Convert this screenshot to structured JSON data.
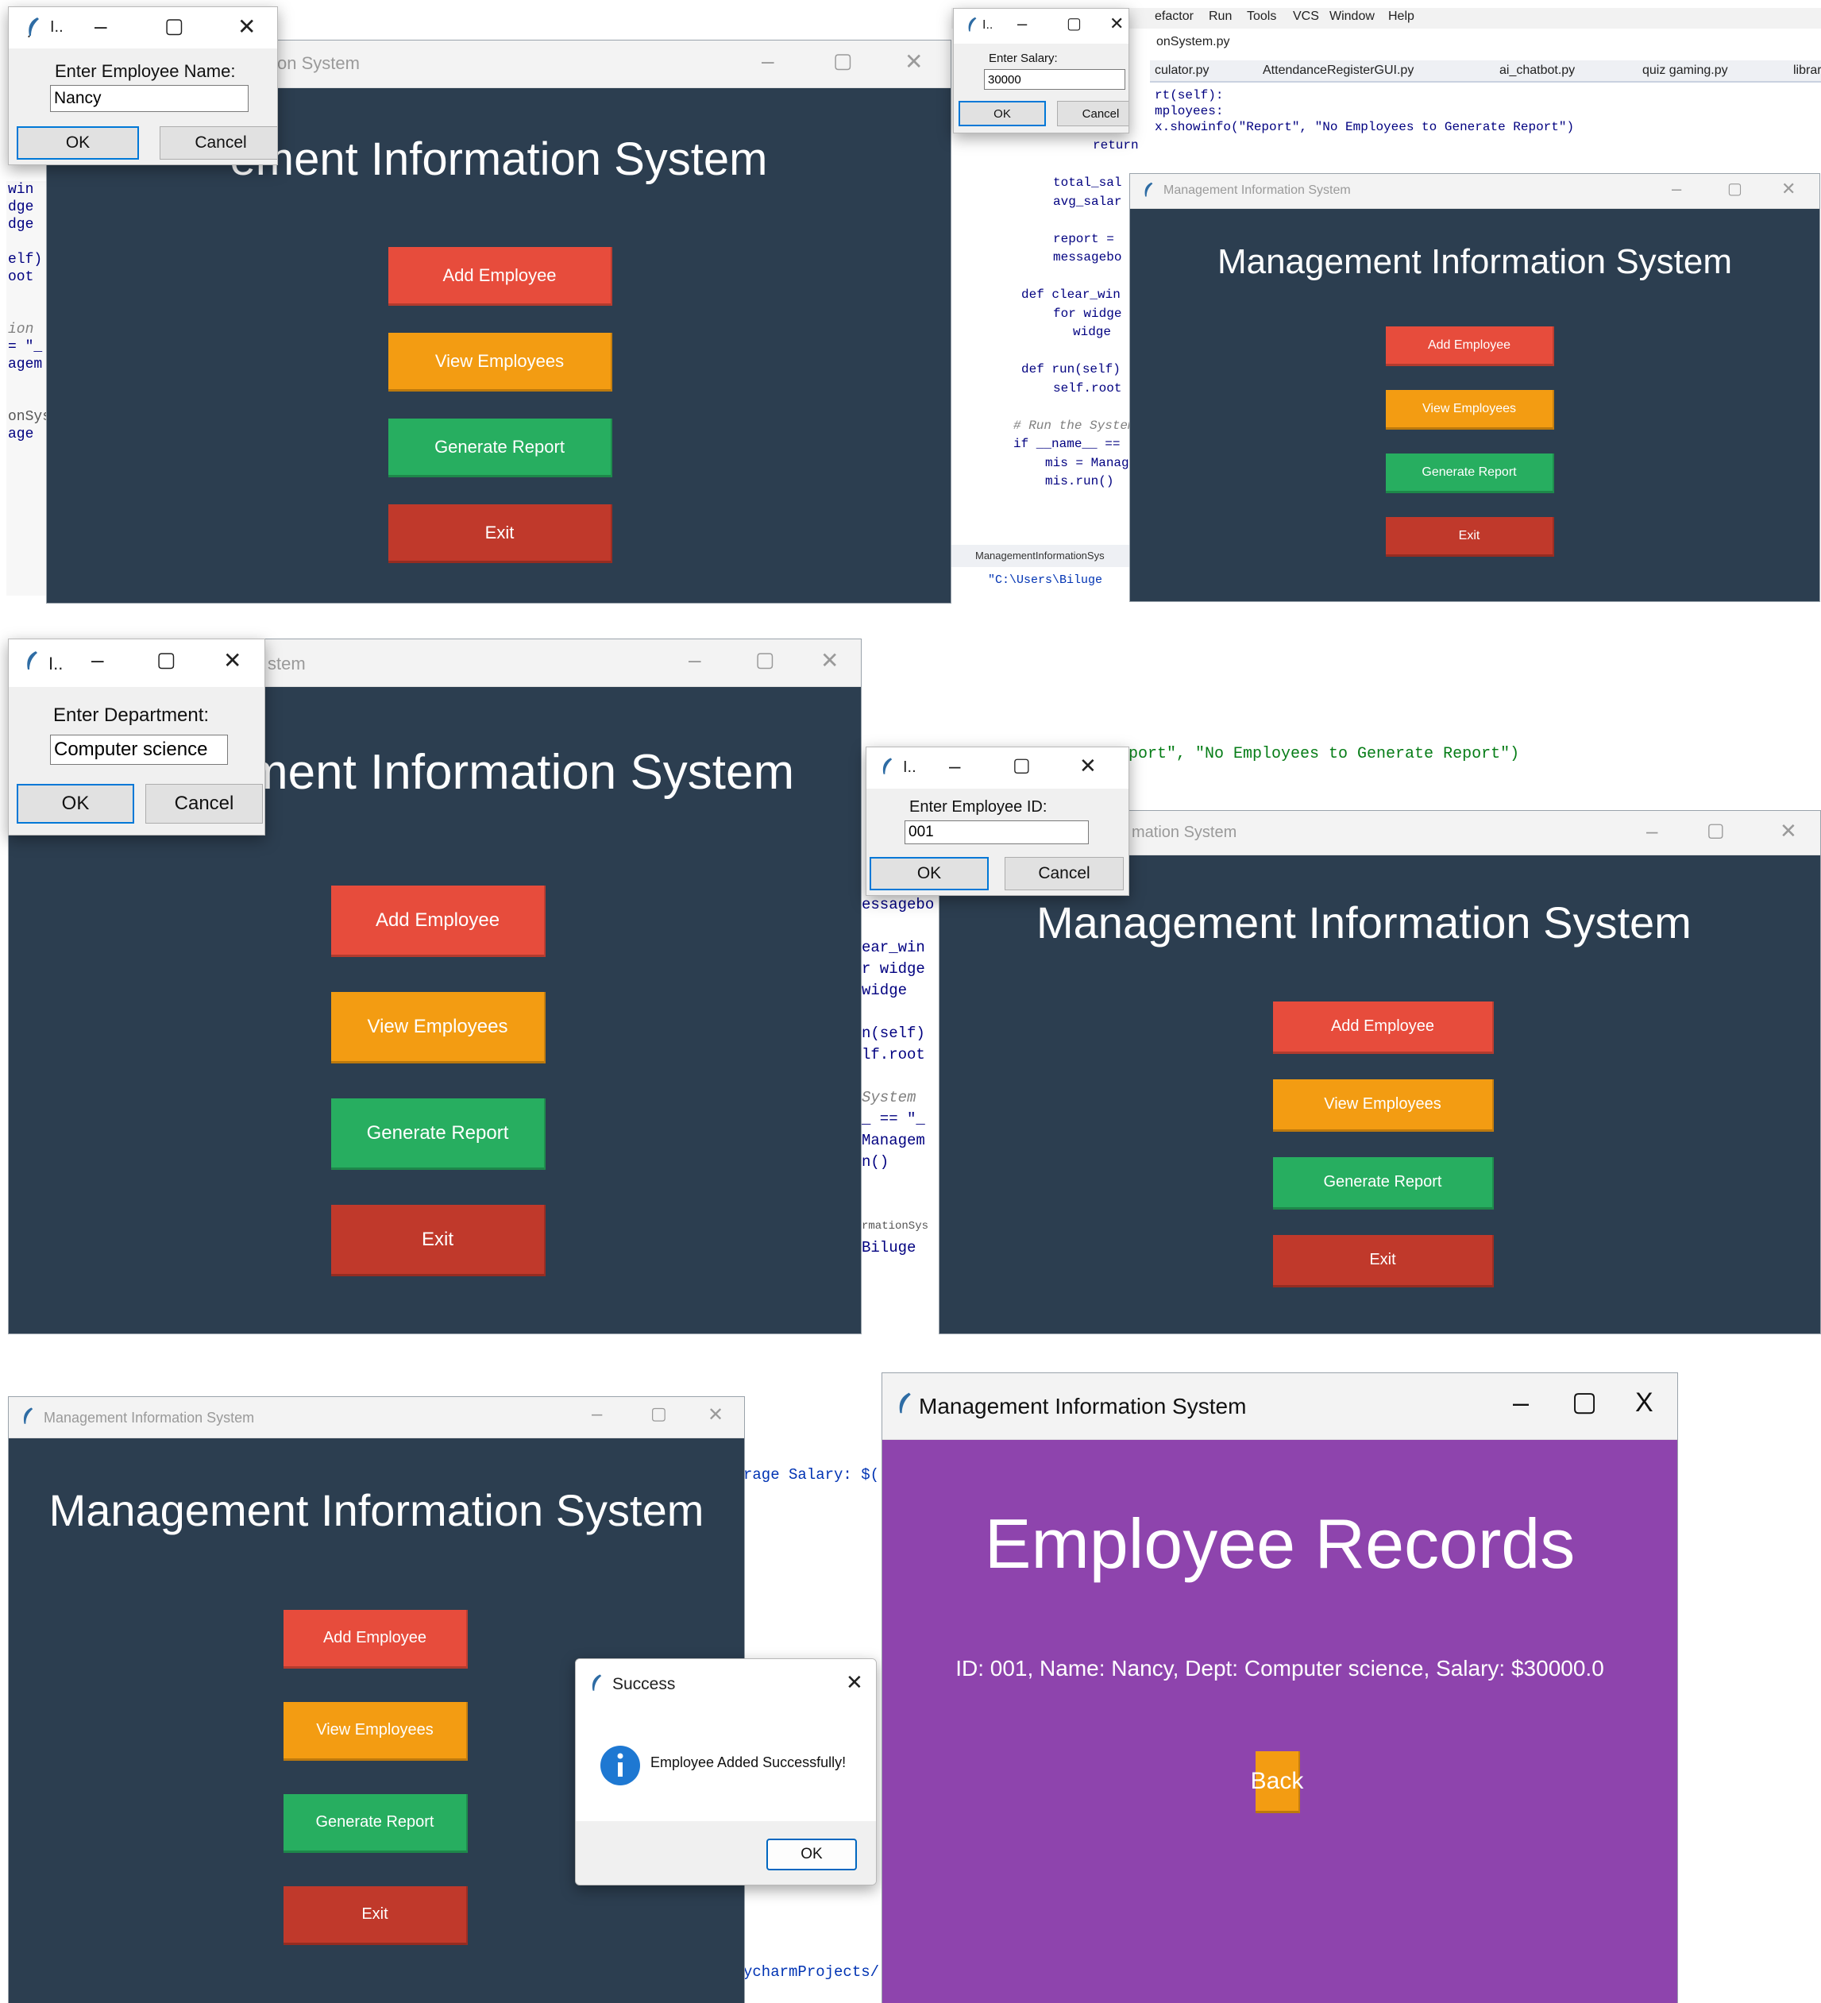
{
  "app": {
    "title": "Management Information System",
    "title_partial_1": "on System",
    "title_partial_2": "stem",
    "title_partial_3": "mation System",
    "short_title": "I..",
    "heading": "Management Information System",
    "heading_partial_1": "ement Information System",
    "heading_partial_2": "ment Information System"
  },
  "buttons": {
    "add": "Add Employee",
    "view": "View Employees",
    "report": "Generate Report",
    "exit": "Exit"
  },
  "window_controls": {
    "min": "–",
    "max": "▢",
    "close": "✕",
    "close_x": "X"
  },
  "dialogs": {
    "name": {
      "label": "Enter Employee Name:",
      "value": "Nancy",
      "ok": "OK",
      "cancel": "Cancel"
    },
    "salary": {
      "label": "Enter Salary:",
      "value": "30000",
      "ok": "OK",
      "cancel": "Cancel"
    },
    "department": {
      "label": "Enter Department:",
      "value": "Computer science",
      "ok": "OK",
      "cancel": "Cancel"
    },
    "id": {
      "label": "Enter Employee ID:",
      "value": "001",
      "ok": "OK",
      "cancel": "Cancel"
    },
    "success": {
      "title": "Success",
      "message": "Employee Added Successfully!",
      "ok": "OK",
      "icon": "info-icon"
    }
  },
  "records": {
    "heading": "Employee Records",
    "line": "ID: 001, Name: Nancy, Dept: Computer science, Salary: $30000.0",
    "back": "Back"
  },
  "ide": {
    "menu": [
      "efactor",
      "Run",
      "Tools",
      "VCS",
      "Window",
      "Help"
    ],
    "breadcrumb": "onSystem.py",
    "tabs": [
      "culator.py",
      "AttendanceRegisterGUI.py",
      "ai_chatbot.py",
      "quiz gaming.py",
      "library.py"
    ],
    "code_top": [
      "rt(self):",
      "mployees:",
      "x.showinfo(\"Report\", \"No Employees to Generate Report\")"
    ],
    "code_panel": [
      "return",
      "",
      "total_sal",
      "avg_salar",
      "",
      "report =",
      "messagebo",
      "",
      "def clear_win",
      "for widge",
      "widge",
      "",
      "def run(self)",
      "self.root",
      "",
      "# Run the System",
      "if __name__ == \"_",
      "mis = Managem",
      "mis.run()"
    ],
    "run_tab": "ManagementInformationSys",
    "run_path": "\"C:\\Users\\Biluge",
    "left_fragments": [
      "win",
      "dge",
      "dge",
      "",
      "elf)",
      "oot",
      "",
      "",
      "ion",
      "= \"_",
      "agem",
      "",
      "",
      "onSyst",
      "age"
    ],
    "p4_top": "port\", \"No Employees to Generate Report\")",
    "p4_frag": [
      "essagebo",
      "",
      "ear_win",
      "r widge",
      "  widge",
      "",
      "n(self)",
      "lf.root",
      "",
      "System",
      "_ == \"_",
      "Managem",
      "n()",
      "",
      "",
      "rmationSys",
      "Biluge"
    ],
    "p5_code": "rage Salary: $(",
    "p5_path": "ycharmProjects/"
  },
  "colors": {
    "bg": "#2c3e50",
    "add": "#e74c3c",
    "view": "#f39c12",
    "report": "#27ae60",
    "exit": "#c0392b",
    "records": "#8e44ad"
  }
}
